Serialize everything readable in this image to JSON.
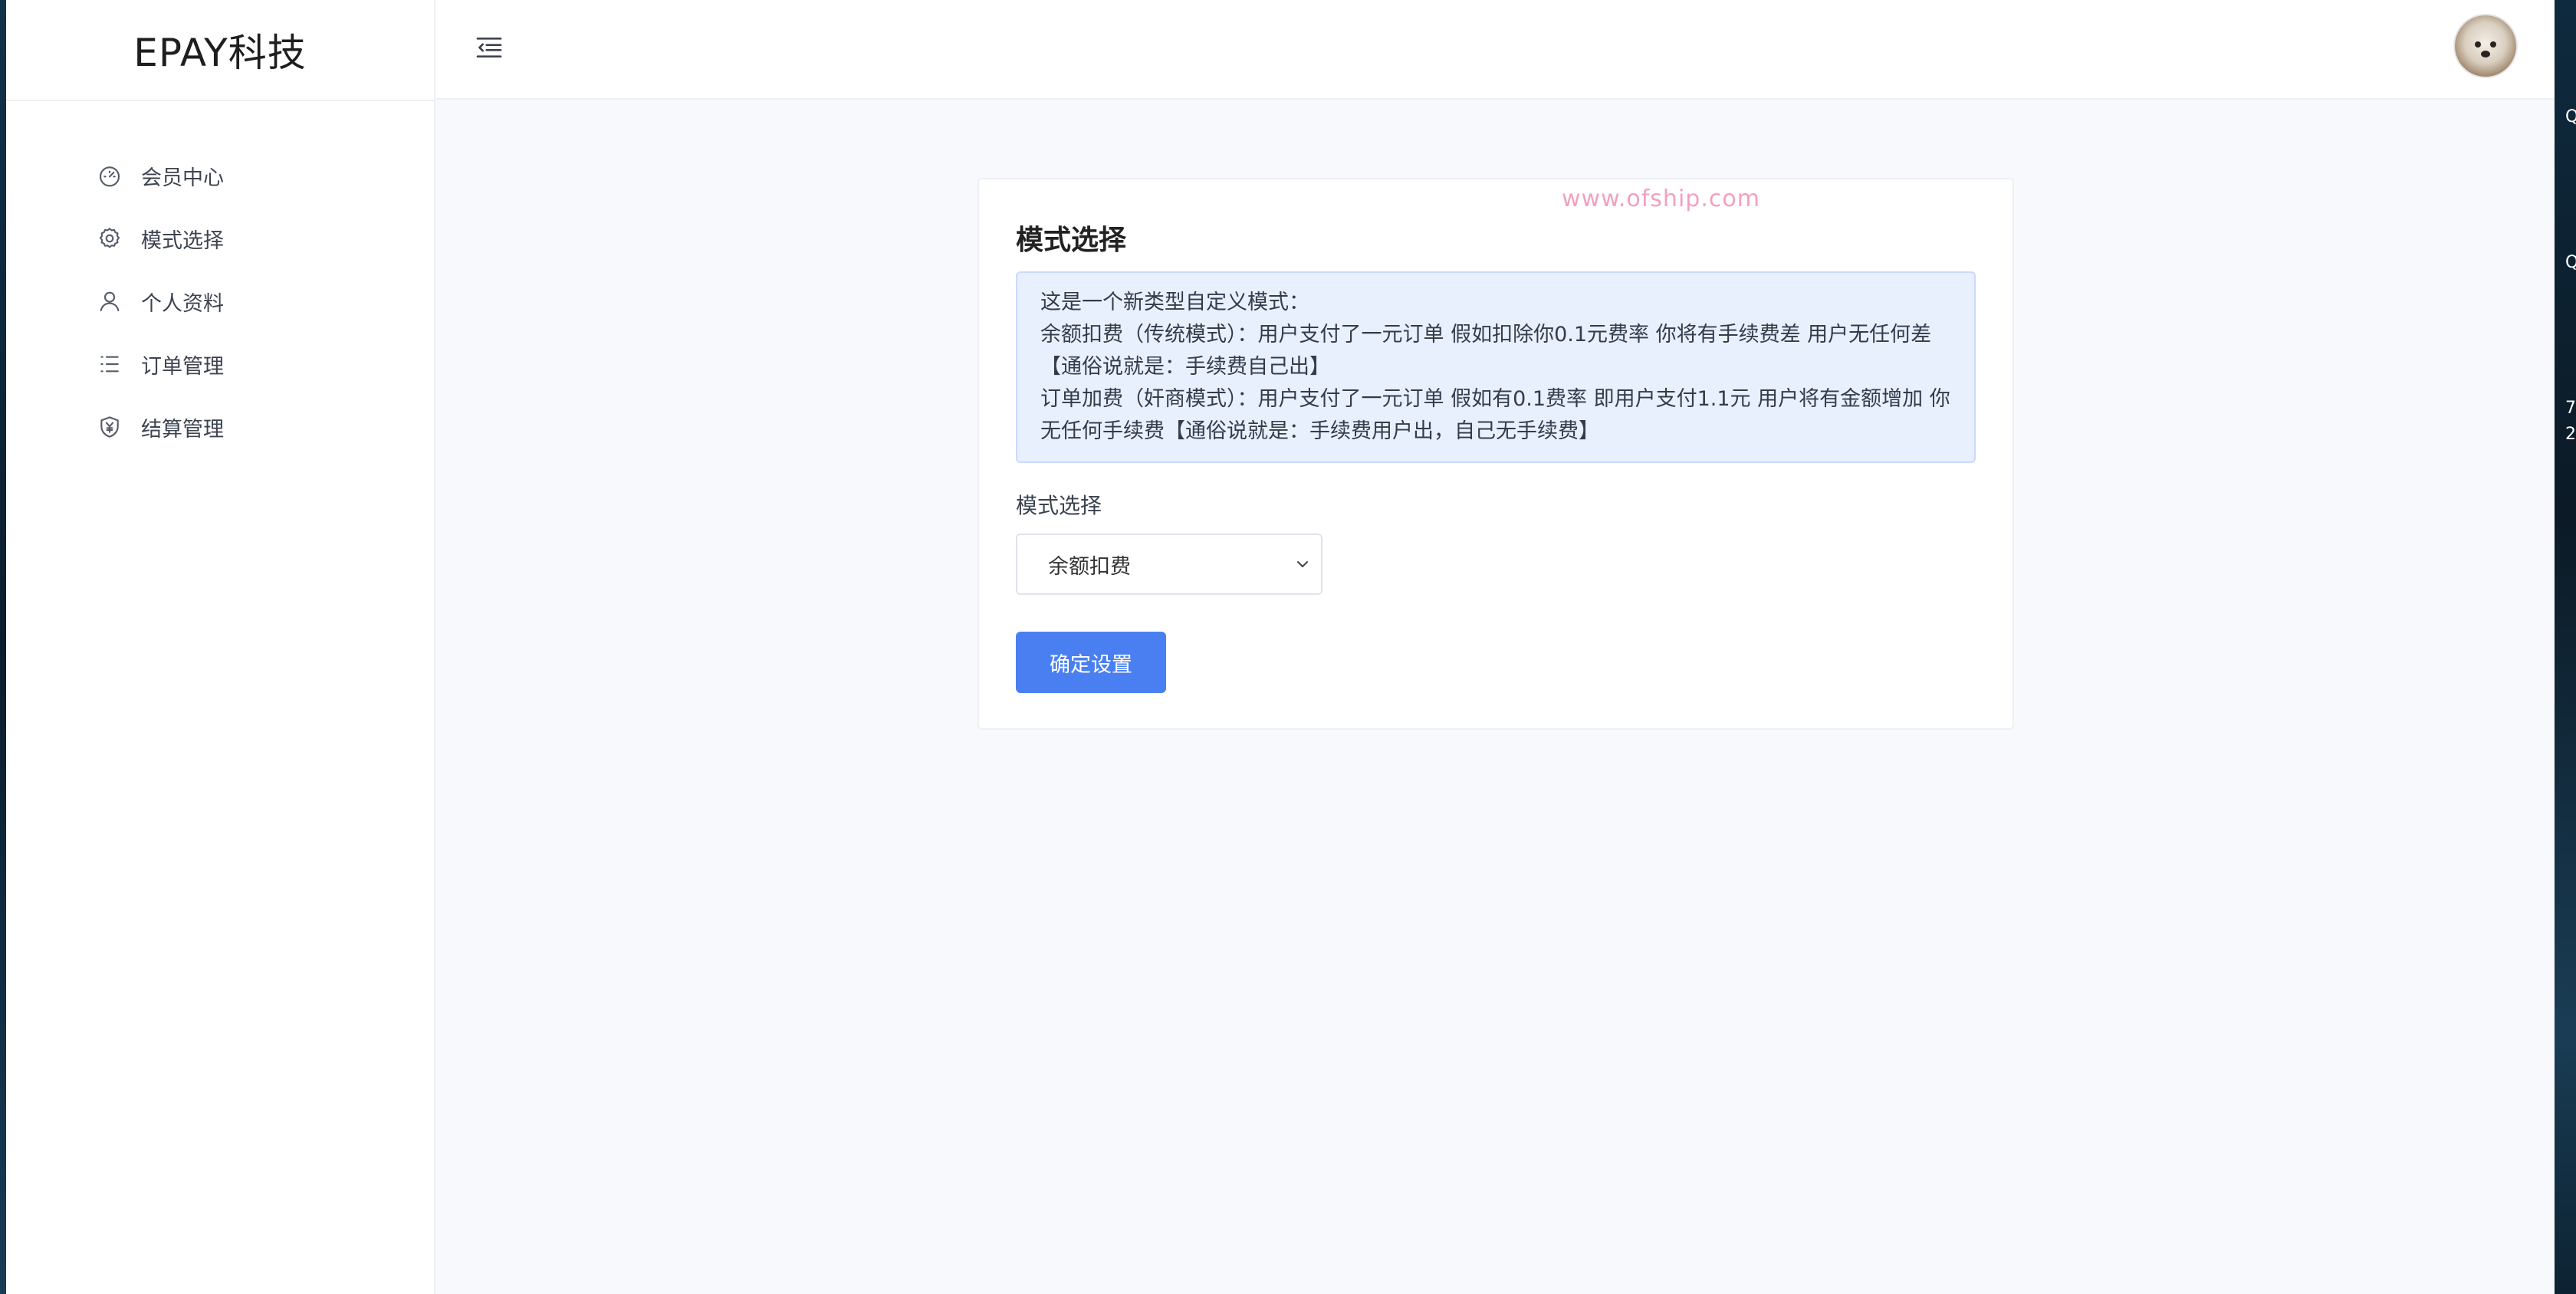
{
  "brand": {
    "title": "EPAY科技"
  },
  "sidebar": {
    "items": [
      {
        "label": "会员中心",
        "icon": "dashboard-gauge-icon"
      },
      {
        "label": "模式选择",
        "icon": "gear-icon"
      },
      {
        "label": "个人资料",
        "icon": "user-icon"
      },
      {
        "label": "订单管理",
        "icon": "list-icon"
      },
      {
        "label": "结算管理",
        "icon": "shield-yen-icon"
      }
    ]
  },
  "header": {
    "toggle_icon": "menu-collapse-icon",
    "avatar_icon": "user-avatar"
  },
  "main": {
    "watermark": "www.ofship.com",
    "card_title": "模式选择",
    "alert_lines": [
      "这是一个新类型自定义模式：",
      "余额扣费（传统模式）：用户支付了一元订单 假如扣除你0.1元费率 你将有手续费差 用户无任何差【通俗说就是：手续费自己出】",
      "订单加费（奸商模式）：用户支付了一元订单 假如有0.1费率 即用户支付1.1元 用户将有金额增加 你无任何手续费【通俗说就是：手续费用户出，自己无手续费】"
    ],
    "field_label": "模式选择",
    "select_value": "余额扣费",
    "submit_label": "确定设置"
  },
  "desktop_edge": {
    "fragments": [
      "Q",
      "Q",
      "7",
      "2"
    ]
  },
  "colors": {
    "primary": "#4a7ff2",
    "alert_bg": "#e8f0fe",
    "page_bg": "#f7f9fc"
  }
}
